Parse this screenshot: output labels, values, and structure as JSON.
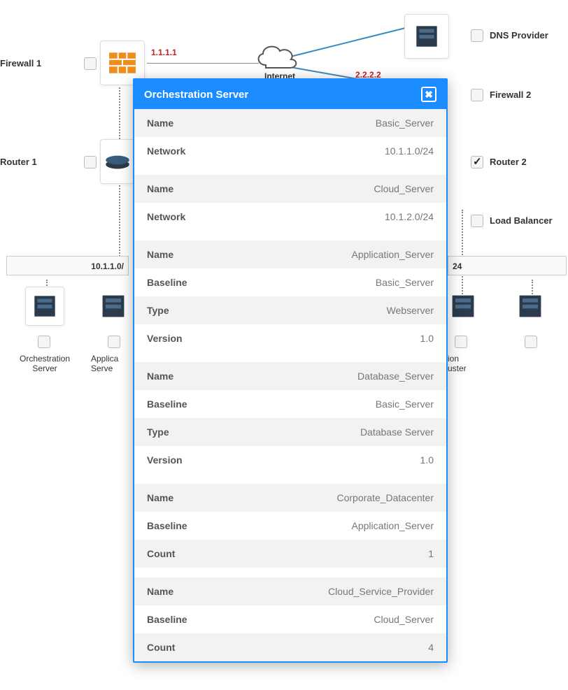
{
  "diagram": {
    "firewall1": {
      "label": "Firewall 1",
      "ip": "1.1.1.1"
    },
    "firewall2": {
      "label": "Firewall 2",
      "ip": "2.2.2.2"
    },
    "dnsProvider": {
      "label": "DNS Provider"
    },
    "router1": {
      "label": "Router 1"
    },
    "router2": {
      "label": "Router 2",
      "checked": true
    },
    "loadBalancer": {
      "label": "Load Balancer"
    },
    "internet": {
      "label": "Internet"
    },
    "subnet1": {
      "label": "10.1.1.0/"
    },
    "subnet2": {
      "label": "24"
    },
    "orchestration": {
      "label1": "Orchestration",
      "label2": "Server"
    },
    "applicationBox": {
      "label1": "Applica",
      "label2": "Serve"
    },
    "applicationRight": {
      "label1": "ion",
      "label2": "uster"
    }
  },
  "dialog": {
    "title": "Orchestration Server",
    "groups": [
      [
        {
          "k": "Name",
          "v": "Basic_Server",
          "shaded": true
        },
        {
          "k": "Network",
          "v": "10.1.1.0/24",
          "shaded": false
        }
      ],
      [
        {
          "k": "Name",
          "v": "Cloud_Server",
          "shaded": true
        },
        {
          "k": "Network",
          "v": "10.1.2.0/24",
          "shaded": false
        }
      ],
      [
        {
          "k": "Name",
          "v": "Application_Server",
          "shaded": true
        },
        {
          "k": "Baseline",
          "v": "Basic_Server",
          "shaded": false
        },
        {
          "k": "Type",
          "v": "Webserver",
          "shaded": true
        },
        {
          "k": "Version",
          "v": "1.0",
          "shaded": false
        }
      ],
      [
        {
          "k": "Name",
          "v": "Database_Server",
          "shaded": true
        },
        {
          "k": "Baseline",
          "v": "Basic_Server",
          "shaded": false
        },
        {
          "k": "Type",
          "v": "Database Server",
          "shaded": true
        },
        {
          "k": "Version",
          "v": "1.0",
          "shaded": false
        }
      ],
      [
        {
          "k": "Name",
          "v": "Corporate_Datacenter",
          "shaded": true
        },
        {
          "k": "Baseline",
          "v": "Application_Server",
          "shaded": false
        },
        {
          "k": "Count",
          "v": "1",
          "shaded": true
        }
      ],
      [
        {
          "k": "Name",
          "v": "Cloud_Service_Provider",
          "shaded": true
        },
        {
          "k": "Baseline",
          "v": "Cloud_Server",
          "shaded": false
        },
        {
          "k": "Count",
          "v": "4",
          "shaded": true
        }
      ]
    ]
  }
}
